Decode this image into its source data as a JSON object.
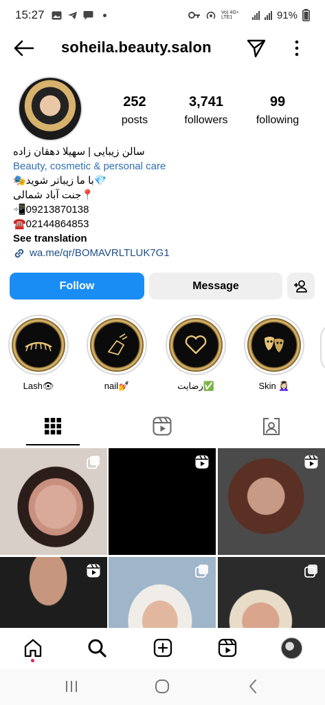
{
  "status_bar": {
    "time": "15:27",
    "network": "Vo) 4G+ LTE1",
    "battery": "91%"
  },
  "header": {
    "username": "soheila.beauty.salon"
  },
  "stats": {
    "posts_count": "252",
    "posts_label": "posts",
    "followers_count": "3,741",
    "followers_label": "followers",
    "following_count": "99",
    "following_label": "following"
  },
  "bio": {
    "name": "سالن زیبایی | سهیلا دهقان زاده",
    "category": "Beauty, cosmetic & personal care",
    "line1": "💎با ما زیباتر شوید🎭",
    "line2": "📍جنت آباد شمالی",
    "phone1": "📲09213870138",
    "phone2": "☎️02144864853",
    "see_translation": "See translation",
    "link": "wa.me/qr/BOMAVRLTLUK7G1"
  },
  "actions": {
    "follow": "Follow",
    "message": "Message"
  },
  "highlights": [
    {
      "label": "Lash👁",
      "icon": "lash-icon"
    },
    {
      "label": "nail💅",
      "icon": "nail-icon"
    },
    {
      "label": "رضایت✅",
      "icon": "heart-icon"
    },
    {
      "label": "Skin 💆🏻‍♀️",
      "icon": "mask-icon"
    }
  ],
  "tabs": [
    "grid-icon",
    "reels-icon",
    "tagged-icon"
  ],
  "grid_posts": [
    {
      "type": "carousel"
    },
    {
      "type": "reel"
    },
    {
      "type": "reel"
    },
    {
      "type": "reel"
    },
    {
      "type": "carousel"
    },
    {
      "type": "carousel"
    }
  ],
  "bottom_nav": [
    "home-icon",
    "search-icon",
    "create-icon",
    "reels-icon",
    "profile-avatar"
  ],
  "colors": {
    "follow_button": "#1a8df5",
    "category_link": "#2f6fb6",
    "web_link": "#1d4e89",
    "secondary_button": "#efefef"
  }
}
